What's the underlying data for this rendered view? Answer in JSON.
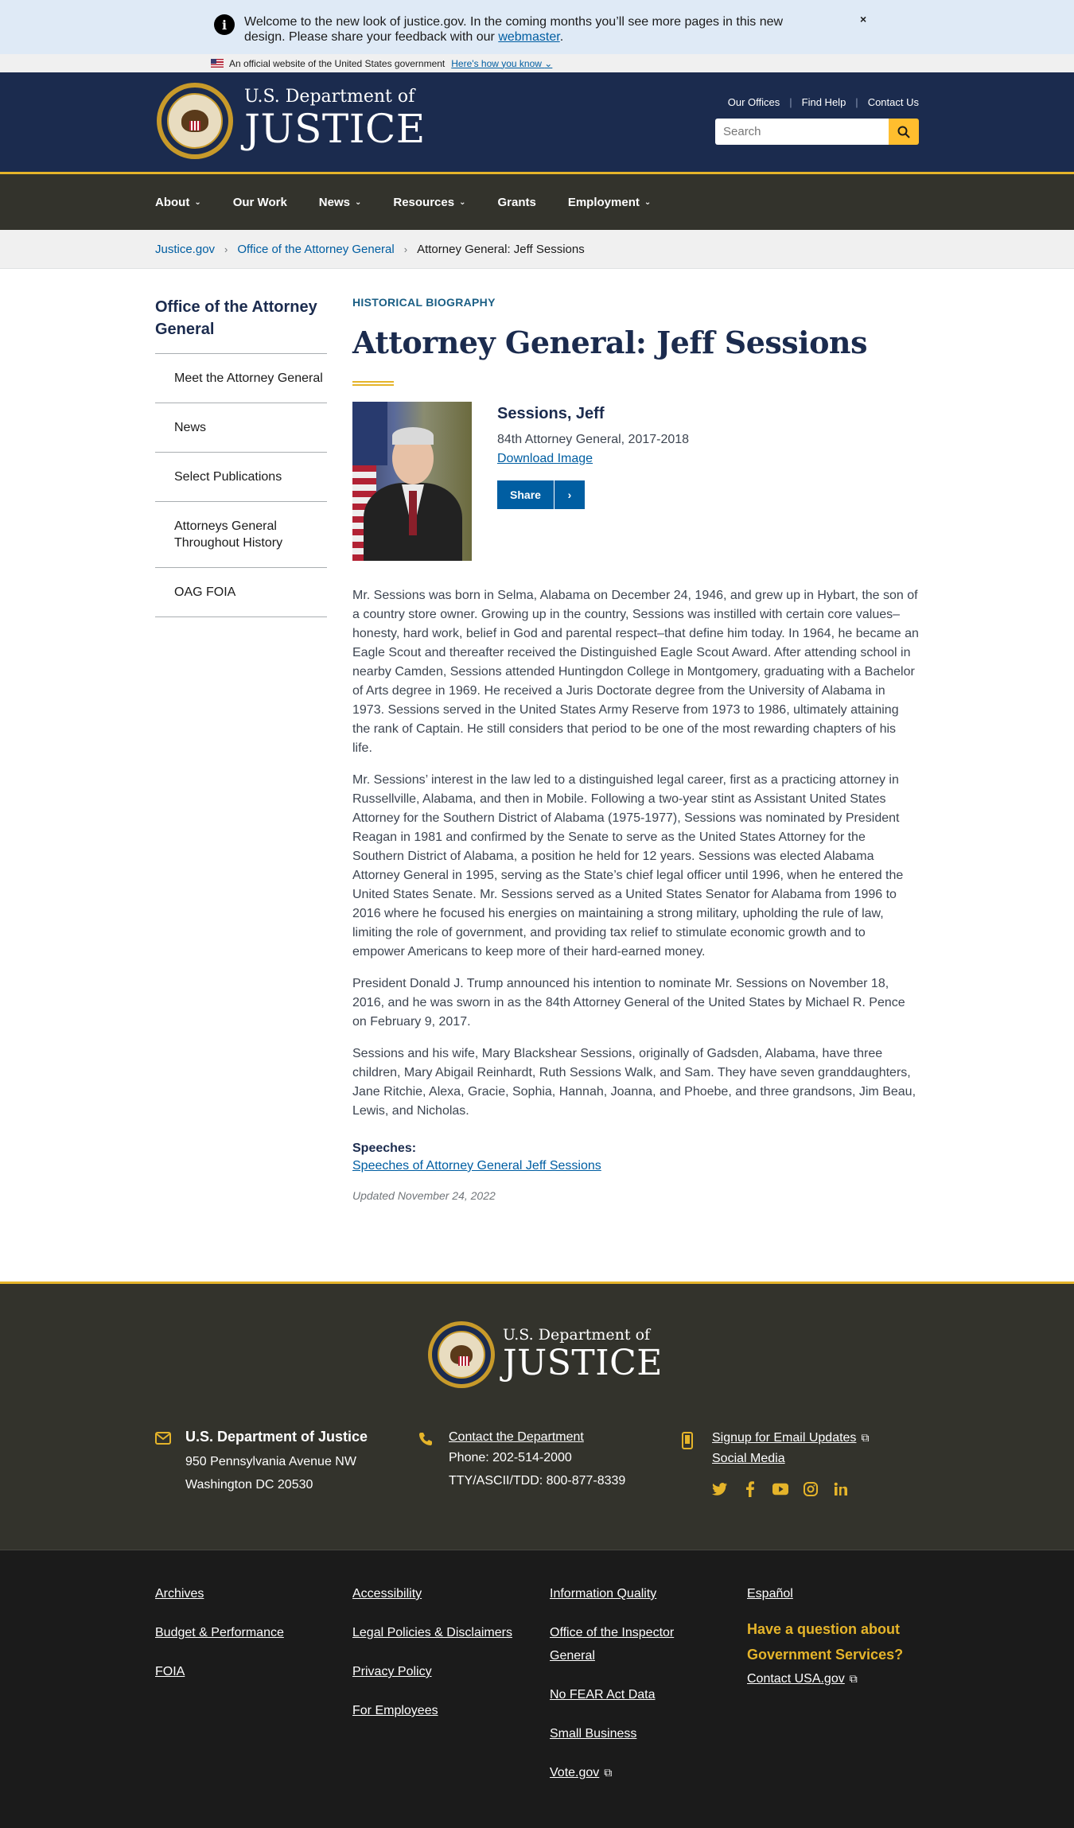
{
  "alert": {
    "message": "Welcome to the new look of justice.gov. In the coming months you’ll see more pages in this new design. Please share your feedback with our",
    "link": "webmaster",
    "period": ".",
    "close": "×"
  },
  "gov_banner": {
    "text": "An official website of the United States government",
    "link": "Here's how you know"
  },
  "header": {
    "logo_top": "U.S. Department of",
    "logo_big": "JUSTICE",
    "links": [
      "Our Offices",
      "Find Help",
      "Contact Us"
    ],
    "search_placeholder": "Search"
  },
  "nav": {
    "items": [
      {
        "label": "About",
        "dropdown": true
      },
      {
        "label": "Our Work",
        "dropdown": false
      },
      {
        "label": "News",
        "dropdown": true
      },
      {
        "label": "Resources",
        "dropdown": true
      },
      {
        "label": "Grants",
        "dropdown": false
      },
      {
        "label": "Employment",
        "dropdown": true
      }
    ],
    "chevron": "⌄"
  },
  "breadcrumb": {
    "items": [
      "Justice.gov",
      "Office of the Attorney General",
      "Attorney General: Jeff Sessions"
    ],
    "sep": "›"
  },
  "sidebar": {
    "title": "Office of the Attorney General",
    "items": [
      "Meet the Attorney General",
      "News",
      "Select Publications",
      "Attorneys General Throughout History",
      "OAG FOIA"
    ]
  },
  "content": {
    "eyebrow": "HISTORICAL BIOGRAPHY",
    "title": "Attorney General: Jeff Sessions",
    "name": "Sessions, Jeff",
    "role": "84th Attorney General, 2017-2018",
    "download": "Download Image",
    "share": "Share",
    "share_chevron": "›",
    "paragraphs": [
      "Mr. Sessions was born in Selma, Alabama on December 24, 1946, and grew up in Hybart, the son of a country store owner. Growing up in the country, Sessions was instilled with certain core values–honesty, hard work, belief in God and parental respect–that define him today. In 1964, he became an Eagle Scout and thereafter received the Distinguished Eagle Scout Award. After attending school in nearby Camden, Sessions attended Huntingdon College in Montgomery, graduating with a Bachelor of Arts degree in 1969. He received a Juris Doctorate degree from the University of Alabama in 1973. Sessions served in the United States Army Reserve from 1973 to 1986, ultimately attaining the rank of Captain. He still considers that period to be one of the most rewarding chapters of his life.",
      "Mr. Sessions’ interest in the law led to a distinguished legal career, first as a practicing attorney in Russellville, Alabama, and then in Mobile. Following a two-year stint as Assistant United States Attorney for the Southern District of Alabama (1975-1977), Sessions was nominated by President Reagan in 1981 and confirmed by the Senate to serve as the United States Attorney for the Southern District of Alabama, a position he held for 12 years. Sessions was elected Alabama Attorney General in 1995, serving as the State’s chief legal officer until 1996, when he entered the United States Senate. Mr. Sessions served as a United States Senator for Alabama from 1996 to 2016 where he focused his energies on maintaining a strong military, upholding the rule of law, limiting the role of government, and providing tax relief to stimulate economic growth and to empower Americans to keep more of their hard-earned money.",
      "President Donald J. Trump announced his intention to nominate Mr. Sessions on November 18, 2016, and he was sworn in as the 84th Attorney General of the United States by Michael R. Pence on February 9, 2017.",
      "Sessions and his wife, Mary Blackshear Sessions, originally of Gadsden, Alabama, have three children, Mary Abigail Reinhardt, Ruth Sessions Walk, and Sam. They have seven granddaughters, Jane Ritchie, Alexa, Gracie, Sophia, Hannah, Joanna, and Phoebe, and three grandsons, Jim Beau, Lewis, and Nicholas."
    ],
    "speeches_heading": "Speeches:",
    "speeches_link": "Speeches of Attorney General Jeff Sessions",
    "updated": "Updated November 24, 2022"
  },
  "footer_top": {
    "logo_top": "U.S. Department of",
    "logo_big": "JUSTICE",
    "address_heading": "U.S. Department of Justice",
    "address_line1": "950 Pennsylvania Avenue NW",
    "address_line2": "Washington DC 20530",
    "contact_link": "Contact the Department",
    "phone": "Phone: 202-514-2000",
    "tty": "TTY/ASCII/TDD: 800-877-8339",
    "email_link": "Signup for Email Updates",
    "social_link": "Social Media",
    "social_icons": [
      "twitter-icon",
      "facebook-icon",
      "youtube-icon",
      "instagram-icon",
      "linkedin-icon"
    ]
  },
  "footer_bottom": {
    "col1": [
      "Archives",
      "Budget & Performance",
      "FOIA"
    ],
    "col2": [
      "Accessibility",
      "Legal Policies & Disclaimers",
      "Privacy Policy",
      "For Employees"
    ],
    "col3": [
      "Information Quality",
      "Office of the Inspector General",
      "No FEAR Act Data",
      "Small Business",
      "Vote.gov"
    ],
    "col4_link": "Español",
    "question": "Have a question about Government Services?",
    "usa_link": "Contact USA.gov"
  },
  "colors": {
    "navy": "#1b2b4e",
    "gold": "#e5b42a",
    "link": "#005ea2",
    "footer_dark": "#33332c"
  }
}
